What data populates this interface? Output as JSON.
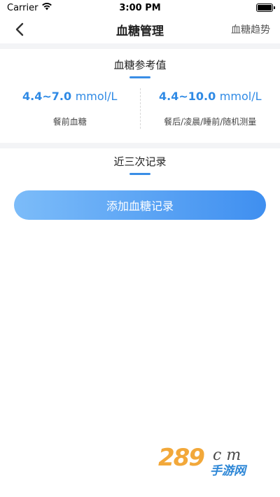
{
  "status_bar": {
    "carrier": "Carrier",
    "time": "3:00 PM",
    "icons": [
      "wifi-icon",
      "battery-icon"
    ]
  },
  "nav": {
    "back_icon": "chevron-left-icon",
    "title": "血糖管理",
    "right_action": "血糖趋势"
  },
  "reference": {
    "title": "血糖参考值",
    "items": [
      {
        "range": "4.4~7.0",
        "unit": "mmol/L",
        "label": "餐前血糖"
      },
      {
        "range": "4.4~10.0",
        "unit": "mmol/L",
        "label": "餐后/凌晨/睡前/随机测量"
      }
    ]
  },
  "records": {
    "title": "近三次记录"
  },
  "add_button": {
    "label": "添加血糖记录"
  },
  "watermark": {
    "num": "289",
    "com": "c m",
    "cn": "手游网"
  },
  "colors": {
    "accent": "#2f8ae5",
    "button_start": "#7cbcf9",
    "button_end": "#3f8ff0"
  }
}
